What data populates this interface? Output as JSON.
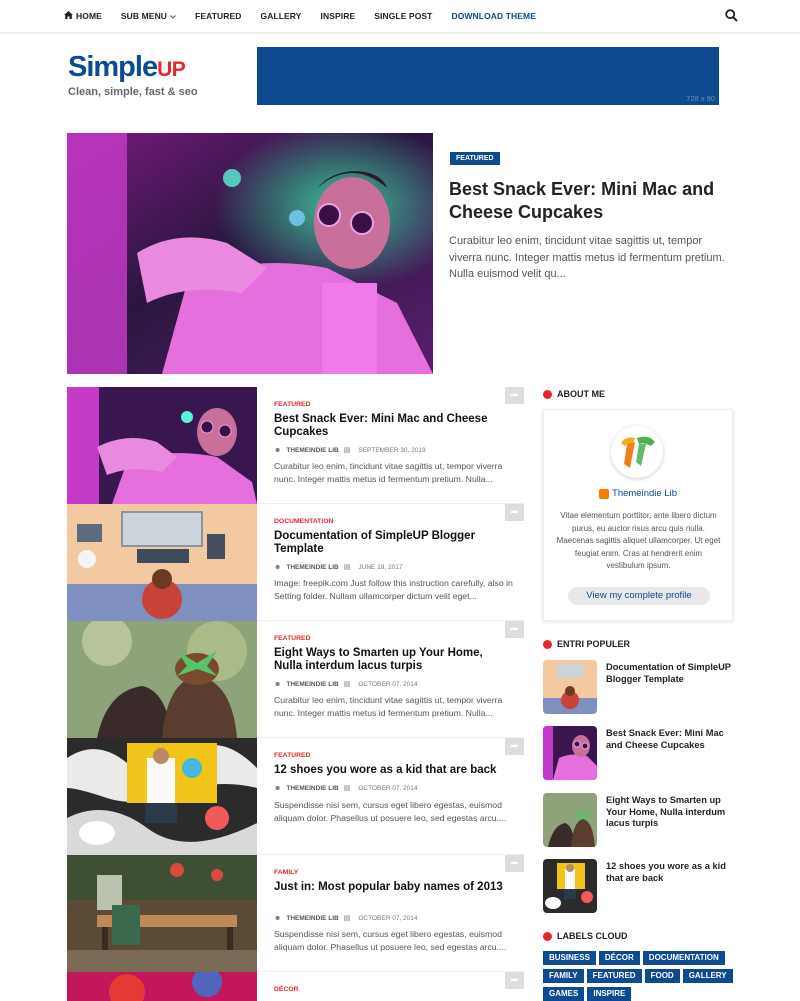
{
  "nav": {
    "items": [
      {
        "label": "HOME",
        "icon": "home-icon"
      },
      {
        "label": "SUB MENU",
        "icon": "chevron-down-icon"
      },
      {
        "label": "FEATURED"
      },
      {
        "label": "GALLERY"
      },
      {
        "label": "INSPIRE"
      },
      {
        "label": "SINGLE POST"
      },
      {
        "label": "DOWNLOAD THEME"
      }
    ],
    "search_icon": "search-icon"
  },
  "header": {
    "logo_main": "Simple",
    "logo_up": "UP",
    "tagline": "Clean, simple, fast & seo",
    "ad_size": "728 x 90"
  },
  "hero": {
    "badge": "FEATURED",
    "title": "Best Snack Ever: Mini Mac and Cheese Cupcakes",
    "excerpt": "Curabitur leo enim, tincidunt vitae sagittis ut, tempor viverra nunc. Integer mattis metus id fermentum pretium. Nulla euismod velit qu..."
  },
  "posts": [
    {
      "category": "FEATURED",
      "title": "Best Snack Ever: Mini Mac and Cheese Cupcakes",
      "author": "THEMEINDIE LIB",
      "date": "SEPTEMBER 30, 2019",
      "excerpt": "Curabitur leo enim, tincidunt vitae sagittis ut, tempor viverra nunc. Integer mattis metus id fermentum pretium. Nulla..."
    },
    {
      "category": "DOCUMENTATION",
      "title": "Documentation of SimpleUP Blogger Template",
      "author": "THEMEINDIE LIB",
      "date": "JUNE 19, 2017",
      "excerpt": "Image: freepik.com Just follow this instruction carefully, also in Setting folder. Nullam ullamcorper dictum velit eget..."
    },
    {
      "category": "FEATURED",
      "title": "Eight Ways to Smarten up Your Home, Nulla interdum lacus turpis",
      "author": "THEMEINDIE LIB",
      "date": "OCTOBER 07, 2014",
      "excerpt": "Curabitur leo enim, tincidunt vitae sagittis ut, tempor viverra nunc. Integer mattis metus id fermentum pretium. Nulla..."
    },
    {
      "category": "FEATURED",
      "title": "12 shoes you wore as a kid that are back",
      "author": "THEMEINDIE LIB",
      "date": "OCTOBER 07, 2014",
      "excerpt": "Suspendisse nisi sem, cursus eget libero egestas, euismod aliquam dolor. Phasellus ut posuere leo, sed egestas arcu...."
    },
    {
      "category": "FAMILY",
      "title": "Just in: Most popular baby names of 2013",
      "author": "THEMEINDIE LIB",
      "date": "OCTOBER 07, 2014",
      "excerpt": "Suspendisse nisi sem, cursus eget libero egestas, euismod aliquam dolor. Phasellus ut posuere leo, sed egestas arcu...."
    },
    {
      "category": "DÉCOR",
      "title": "",
      "author": "",
      "date": "",
      "excerpt": ""
    }
  ],
  "sidebar": {
    "about_title": "ABOUT ME",
    "profile_name": "Themeindie Lib",
    "about_text": "Vitae elementum porttitor, ante libero dictum purus, eu auctor risus arcu quis nulla. Maecenas sagittis aliquet ullamcorper. Ut eget feugiat enim. Cras at hendrerit enim vestibulum ipsum.",
    "profile_button": "View my complete profile",
    "popular_title": "ENTRI POPULER",
    "popular": [
      {
        "title": "Documentation of SimpleUP Blogger Template"
      },
      {
        "title": "Best Snack Ever: Mini Mac and Cheese Cupcakes"
      },
      {
        "title": "Eight Ways to Smarten up Your Home, Nulla interdum lacus turpis"
      },
      {
        "title": "12 shoes you wore as a kid that are back"
      }
    ],
    "labels_title": "LABELS CLOUD",
    "labels": [
      "BUSINESS",
      "DÉCOR",
      "DOCUMENTATION",
      "FAMILY",
      "FEATURED",
      "FOOD",
      "GALLERY",
      "GAMES",
      "INSPIRE"
    ]
  },
  "colors": {
    "brand_blue": "#0d4a8f",
    "accent_red": "#e3272d"
  }
}
